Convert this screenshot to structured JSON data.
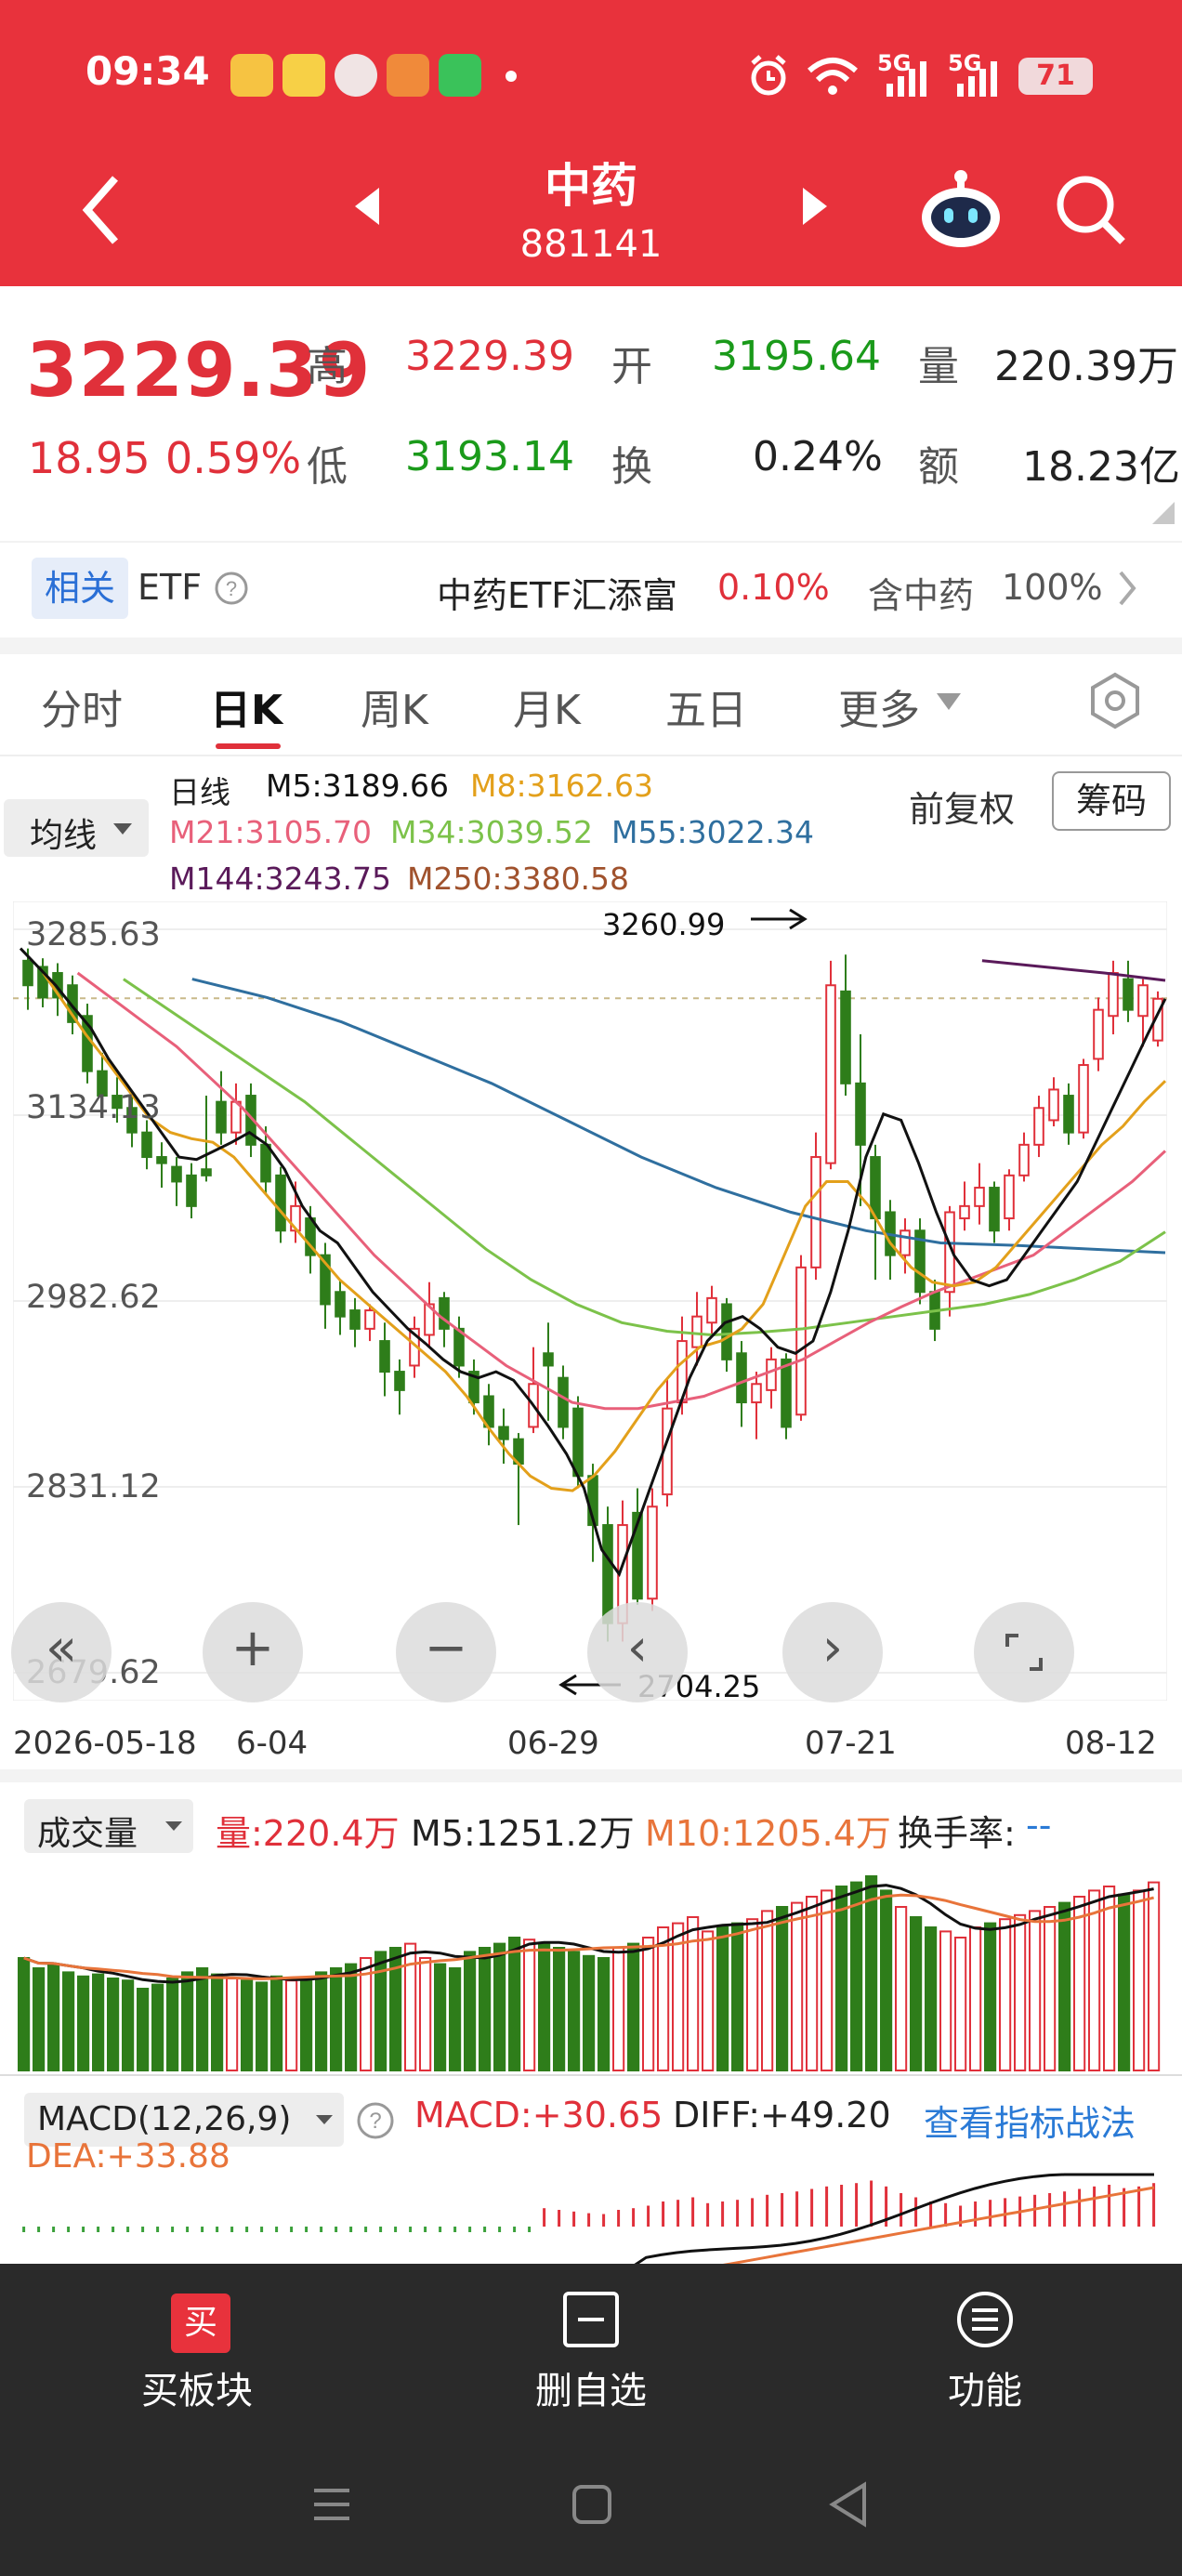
{
  "status_bar": {
    "time": "09:34",
    "signal1": "5G",
    "signal2": "5G",
    "battery": "71"
  },
  "nav": {
    "title": "中药",
    "code": "881141"
  },
  "quote": {
    "price": "3229.39",
    "change": "18.95",
    "change_pct": "0.59%",
    "high_label": "高",
    "high": "3229.39",
    "open_label": "开",
    "open": "3195.64",
    "volume_label": "量",
    "volume": "220.39万",
    "low_label": "低",
    "low": "3193.14",
    "turnover_label": "换",
    "turnover": "0.24%",
    "amount_label": "额",
    "amount": "18.23亿"
  },
  "etf": {
    "badge": "相关",
    "etf_label": "ETF",
    "name": "中药ETF汇添富",
    "pct": "0.10%",
    "hold_label": "含中药",
    "hold_pct": "100%"
  },
  "tabs": [
    "分时",
    "日K",
    "周K",
    "月K",
    "五日",
    "更多"
  ],
  "ma_legend": {
    "selector": "均线",
    "daily": "日线",
    "m5": "M5:3189.66",
    "m8": "M8:3162.63",
    "m21": "M21:3105.70",
    "m34": "M34:3039.52",
    "m55": "M55:3022.34",
    "m144": "M144:3243.75",
    "m250": "M250:3380.58",
    "fq": "前复权",
    "chips": "筹码"
  },
  "colors": {
    "header": "#e8323c",
    "up": "#e0303a",
    "down": "#2e7d1a",
    "m5": "#111111",
    "m8": "#e3a01b",
    "m21": "#e8607a",
    "m34": "#7cc24a",
    "m55": "#2f6f9f",
    "m144": "#5a1a5a",
    "m250": "#a0522d"
  },
  "chart_data": {
    "type": "candlestick",
    "y_ticks": [
      "3285.63",
      "3134.13",
      "2982.62",
      "2831.12",
      "2679.62"
    ],
    "ylim": [
      2679.62,
      3285.63
    ],
    "x_labels": [
      "2026-05-18",
      "6-04",
      "06-29",
      "07-21",
      "08-12"
    ],
    "annotation_high": "3260.99",
    "annotation_low": "2704.25",
    "candles": [
      [
        3260,
        3270,
        3240,
        3220
      ],
      [
        3255,
        3262,
        3230,
        3222
      ],
      [
        3250,
        3258,
        3230,
        3215
      ],
      [
        3240,
        3248,
        3210,
        3200
      ],
      [
        3215,
        3225,
        3170,
        3160
      ],
      [
        3170,
        3185,
        3150,
        3140
      ],
      [
        3150,
        3165,
        3140,
        3128
      ],
      [
        3140,
        3152,
        3120,
        3108
      ],
      [
        3120,
        3130,
        3100,
        3090
      ],
      [
        3100,
        3112,
        3095,
        3075
      ],
      [
        3092,
        3100,
        3080,
        3060
      ],
      [
        3085,
        3095,
        3060,
        3050
      ],
      [
        3090,
        3150,
        3085,
        3080
      ],
      [
        3145,
        3170,
        3120,
        3110
      ],
      [
        3120,
        3160,
        3145,
        3110
      ],
      [
        3150,
        3160,
        3110,
        3100
      ],
      [
        3110,
        3125,
        3080,
        3070
      ],
      [
        3085,
        3092,
        3040,
        3030
      ],
      [
        3040,
        3080,
        3060,
        3030
      ],
      [
        3050,
        3060,
        3020,
        3005
      ],
      [
        3020,
        3030,
        2980,
        2960
      ],
      [
        2990,
        3000,
        2970,
        2955
      ],
      [
        2975,
        2985,
        2960,
        2945
      ],
      [
        2960,
        2980,
        2975,
        2950
      ],
      [
        2950,
        2965,
        2925,
        2905
      ],
      [
        2925,
        2935,
        2910,
        2890
      ],
      [
        2930,
        2970,
        2960,
        2920
      ],
      [
        2955,
        2998,
        2980,
        2945
      ],
      [
        2985,
        2990,
        2960,
        2945
      ],
      [
        2960,
        2970,
        2930,
        2920
      ],
      [
        2925,
        2935,
        2900,
        2890
      ],
      [
        2905,
        2915,
        2880,
        2865
      ],
      [
        2880,
        2895,
        2870,
        2850
      ],
      [
        2870,
        2875,
        2850,
        2800
      ],
      [
        2880,
        2945,
        2915,
        2875
      ],
      [
        2940,
        2965,
        2930,
        2885
      ],
      [
        2920,
        2930,
        2880,
        2870
      ],
      [
        2895,
        2905,
        2840,
        2830
      ],
      [
        2840,
        2850,
        2800,
        2770
      ],
      [
        2800,
        2815,
        2720,
        2705
      ],
      [
        2720,
        2820,
        2800,
        2705
      ],
      [
        2810,
        2830,
        2740,
        2735
      ],
      [
        2740,
        2830,
        2815,
        2730
      ],
      [
        2825,
        2920,
        2895,
        2815
      ],
      [
        2900,
        2970,
        2950,
        2890
      ],
      [
        2945,
        2990,
        2970,
        2930
      ],
      [
        2965,
        2995,
        2985,
        2955
      ],
      [
        2980,
        2985,
        2935,
        2925
      ],
      [
        2940,
        2950,
        2900,
        2880
      ],
      [
        2900,
        2925,
        2915,
        2870
      ],
      [
        2910,
        2945,
        2935,
        2895
      ],
      [
        2935,
        2940,
        2880,
        2870
      ],
      [
        2890,
        3020,
        3010,
        2885
      ],
      [
        3010,
        3120,
        3100,
        3000
      ],
      [
        3095,
        3260,
        3240,
        3090
      ],
      [
        3235,
        3265,
        3160,
        3150
      ],
      [
        3160,
        3200,
        3110,
        3060
      ],
      [
        3100,
        3110,
        3050,
        3000
      ],
      [
        3055,
        3065,
        3020,
        3000
      ],
      [
        3020,
        3050,
        3040,
        3005
      ],
      [
        3040,
        3050,
        2990,
        2980
      ],
      [
        2990,
        3000,
        2960,
        2950
      ],
      [
        2990,
        3060,
        3055,
        2970
      ],
      [
        3050,
        3080,
        3060,
        3040
      ],
      [
        3060,
        3095,
        3075,
        3045
      ],
      [
        3075,
        3080,
        3040,
        3030
      ],
      [
        3050,
        3090,
        3085,
        3040
      ],
      [
        3085,
        3120,
        3110,
        3080
      ],
      [
        3110,
        3150,
        3140,
        3100
      ],
      [
        3130,
        3165,
        3155,
        3125
      ],
      [
        3150,
        3160,
        3120,
        3110
      ],
      [
        3120,
        3180,
        3175,
        3115
      ],
      [
        3180,
        3230,
        3220,
        3170
      ],
      [
        3215,
        3260,
        3250,
        3200
      ],
      [
        3245,
        3260,
        3220,
        3210
      ],
      [
        3215,
        3245,
        3240,
        3190
      ],
      [
        3195,
        3235,
        3229,
        3190
      ]
    ],
    "m5": [
      3270,
      3255,
      3240,
      3222,
      3205,
      3180,
      3160,
      3140,
      3120,
      3100,
      3098,
      3105,
      3112,
      3120,
      3110,
      3090,
      3060,
      3040,
      3030,
      3010,
      2990,
      2975,
      2960,
      2948,
      2935,
      2925,
      2920,
      2925,
      2918,
      2900,
      2880,
      2858,
      2830,
      2780,
      2760,
      2800,
      2840,
      2880,
      2920,
      2950,
      2965,
      2970,
      2960,
      2945,
      2940,
      2950,
      2990,
      3040,
      3100,
      3135,
      3130,
      3095,
      3055,
      3020,
      3000,
      2995,
      3000,
      3020,
      3040,
      3060,
      3080,
      3110,
      3140,
      3170,
      3200,
      3229
    ],
    "m8": [
      3250,
      3225,
      3200,
      3178,
      3155,
      3132,
      3120,
      3115,
      3112,
      3100,
      3080,
      3060,
      3040,
      3020,
      3000,
      2985,
      2970,
      2955,
      2940,
      2925,
      2905,
      2880,
      2858,
      2840,
      2830,
      2828,
      2840,
      2860,
      2885,
      2910,
      2930,
      2945,
      2950,
      2960,
      2980,
      3020,
      3060,
      3080,
      3080,
      3060,
      3030,
      3010,
      2998,
      2995,
      2998,
      3010,
      3030,
      3050,
      3070,
      3090,
      3110,
      3125,
      3145,
      3162
    ],
    "m21": [
      3250,
      3230,
      3210,
      3190,
      3165,
      3140,
      3110,
      3080,
      3050,
      3020,
      2995,
      2970,
      2950,
      2930,
      2915,
      2900,
      2895,
      2895,
      2900,
      2905,
      2915,
      2925,
      2935,
      2950,
      2965,
      2978,
      2990,
      3000,
      3010,
      3020,
      3040,
      3060,
      3080,
      3105
    ],
    "m34": [
      3245,
      3220,
      3195,
      3170,
      3145,
      3115,
      3085,
      3055,
      3025,
      3000,
      2980,
      2965,
      2958,
      2955,
      2957,
      2960,
      2965,
      2970,
      2975,
      2980,
      2988,
      3000,
      3015,
      3039
    ],
    "m55": [
      3245,
      3230,
      3210,
      3185,
      3160,
      3130,
      3100,
      3075,
      3055,
      3040,
      3030,
      3028,
      3025,
      3022
    ],
    "m144": [
      3260,
      3255,
      3250,
      3244
    ],
    "volume": {
      "label": "成交量",
      "vol": "量:220.4万",
      "m5": "M5:1251.2万",
      "m10": "M10:1205.4万",
      "turnover_rate_label": "换手率:",
      "turnover_rate": "--",
      "bars": [
        55,
        50,
        52,
        48,
        46,
        47,
        45,
        44,
        40,
        42,
        45,
        48,
        50,
        47,
        45,
        44,
        43,
        46,
        44,
        45,
        48,
        50,
        52,
        55,
        58,
        60,
        62,
        55,
        52,
        50,
        58,
        60,
        62,
        65,
        64,
        62,
        60,
        58,
        56,
        55,
        60,
        62,
        65,
        70,
        72,
        75,
        68,
        70,
        72,
        74,
        78,
        80,
        82,
        85,
        88,
        90,
        92,
        95,
        88,
        80,
        75,
        70,
        68,
        65,
        70,
        72,
        74,
        76,
        78,
        80,
        82,
        85,
        88,
        90,
        86,
        88,
        92
      ]
    },
    "macd": {
      "label": "MACD(12,26,9)",
      "macd": "MACD:+30.65",
      "diff": "DIFF:+49.20",
      "dea": "DEA:+33.88",
      "strategy_link": "查看指标战法"
    }
  },
  "bottom_bar": {
    "buy_icon": "买",
    "buy": "买板块",
    "remove": "删自选",
    "func": "功能"
  }
}
